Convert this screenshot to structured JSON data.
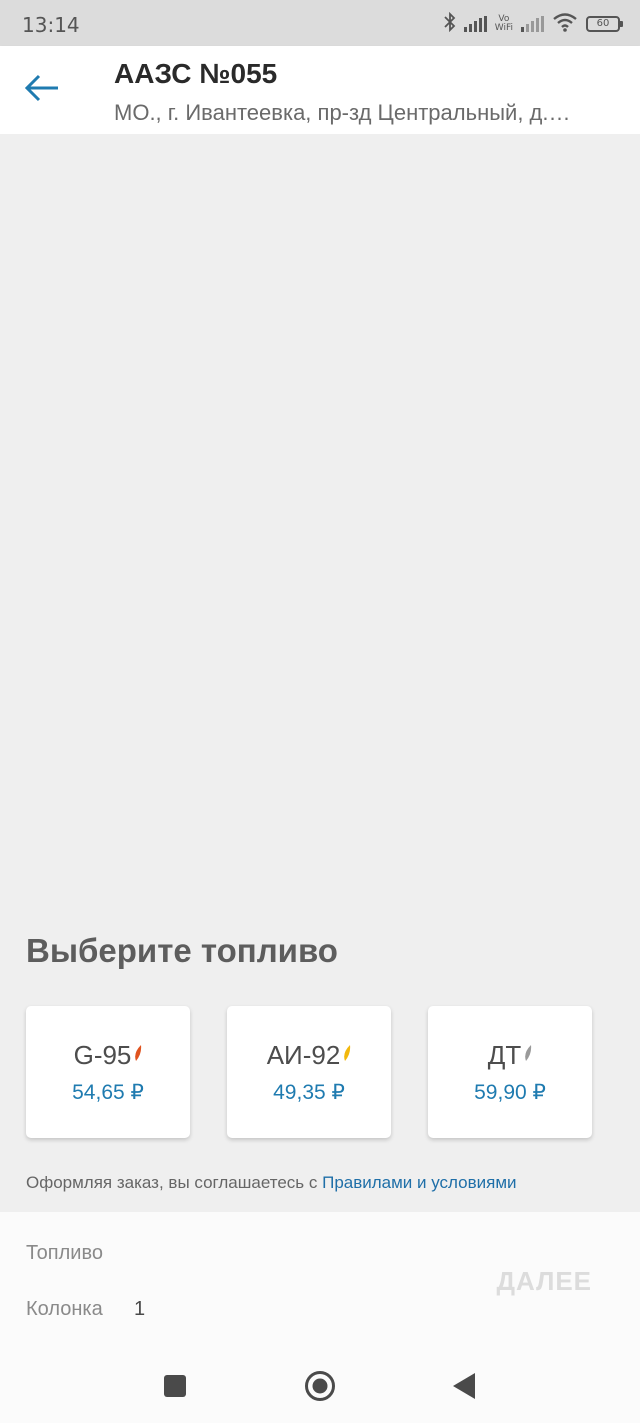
{
  "status_bar": {
    "time": "13:14",
    "vowifi_top": "Vo",
    "vowifi_bottom": "WiFi",
    "battery": "60",
    "icons": [
      "bluetooth-icon",
      "signal-icon",
      "vowifi-icon",
      "signal-icon",
      "wifi-icon",
      "battery-icon"
    ]
  },
  "header": {
    "back_icon": "arrow-left-icon",
    "title": "ААЗС №055",
    "subtitle": "МО., г. Ивантеевка, пр-зд Центральный, д.…"
  },
  "fuel_section": {
    "title": "Выберите топливо",
    "options": [
      {
        "name": "G-95",
        "price": "54,65 ₽",
        "leaf_icon": "leaf-icon",
        "leaf_color": "#e0531f"
      },
      {
        "name": "АИ-92",
        "price": "49,35 ₽",
        "leaf_icon": "leaf-icon",
        "leaf_color": "#f2b80c"
      },
      {
        "name": "ДТ",
        "price": "59,90 ₽",
        "leaf_icon": "leaf-icon",
        "leaf_color": "#9a9a9a"
      }
    ]
  },
  "terms": {
    "prefix": "Оформляя заказ, вы соглашаетесь с ",
    "link": "Правилами и условиями"
  },
  "order": {
    "fuel_label": "Топливо",
    "pump_label": "Колонка",
    "pump_value": "1",
    "next_label": "ДАЛЕЕ"
  },
  "nav": {
    "icons": [
      "square-icon",
      "circle-home-icon",
      "triangle-back-icon"
    ]
  },
  "colors": {
    "accent": "#1f7bb0",
    "link": "#1f6fa8",
    "background": "#efefef",
    "disabled_button": "#dcdcdc"
  }
}
